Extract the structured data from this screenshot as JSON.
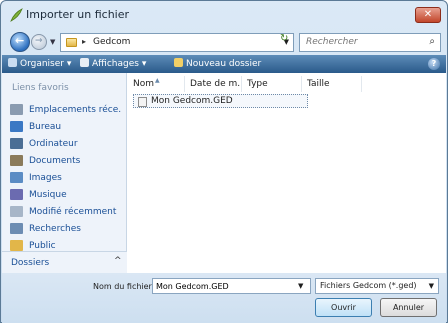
{
  "window": {
    "title": "Importer un fichier",
    "close_label": "✕"
  },
  "address": {
    "path_sep": "▸",
    "current_folder": "Gedcom"
  },
  "search": {
    "placeholder": "Rechercher"
  },
  "toolbar": {
    "organize": "Organiser",
    "views": "Affichages",
    "new_folder": "Nouveau dossier",
    "help": "?"
  },
  "sidebar": {
    "title": "Liens favoris",
    "items": [
      {
        "label": "Emplacements réce...",
        "icon": "recent-places-icon",
        "color": "#8a9bb0"
      },
      {
        "label": "Bureau",
        "icon": "desktop-icon",
        "color": "#3a78c4"
      },
      {
        "label": "Ordinateur",
        "icon": "computer-icon",
        "color": "#4b6e95"
      },
      {
        "label": "Documents",
        "icon": "documents-icon",
        "color": "#8b7b5b"
      },
      {
        "label": "Images",
        "icon": "pictures-icon",
        "color": "#5b8cc4"
      },
      {
        "label": "Musique",
        "icon": "music-icon",
        "color": "#6b6bb0"
      },
      {
        "label": "Modifié récemment",
        "icon": "recently-changed-icon",
        "color": "#a7b6c8"
      },
      {
        "label": "Recherches",
        "icon": "searches-icon",
        "color": "#6d8db3"
      },
      {
        "label": "Public",
        "icon": "public-folder-icon",
        "color": "#e2b649"
      }
    ],
    "folders_label": "Dossiers"
  },
  "columns": [
    {
      "label": "Nom"
    },
    {
      "label": "Date de m..."
    },
    {
      "label": "Type"
    },
    {
      "label": "Taille"
    }
  ],
  "files": [
    {
      "name": "Mon Gedcom.GED"
    }
  ],
  "bottom": {
    "filename_label": "Nom du fichier :",
    "filename_value": "Mon Gedcom.GED",
    "filter_value": "Fichiers Gedcom (*.ged)",
    "open_label": "Ouvrir",
    "cancel_label": "Annuler"
  }
}
